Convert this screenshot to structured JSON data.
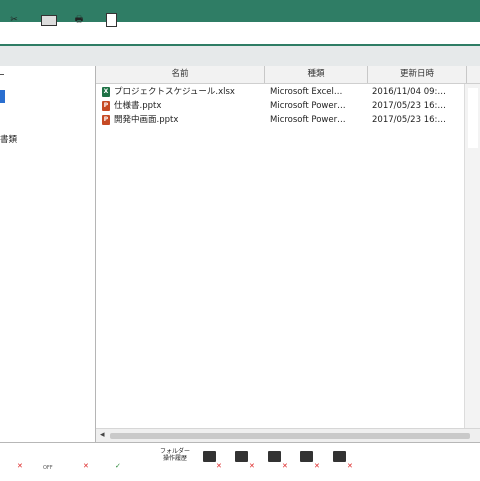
{
  "list_view": {
    "columns": [
      "名前",
      "種類",
      "更新日時"
    ],
    "rows": [
      {
        "name": "プロジェクトスケジュール.xlsx",
        "type": "Microsoft Excel…",
        "date": "2016/11/04 09:…",
        "icon": "excel-file-icon"
      },
      {
        "name": "仕様書.pptx",
        "type": "Microsoft Power…",
        "date": "2017/05/23 16:…",
        "icon": "powerpoint-file-icon"
      },
      {
        "name": "開発中画面.pptx",
        "type": "Microsoft Power…",
        "date": "2017/05/23 16:…",
        "icon": "powerpoint-file-icon"
      }
    ]
  },
  "tree": {
    "label": "書類"
  },
  "toolbar": {
    "folder_history": "フォルダー\n操作履歴",
    "off_label": "OFF"
  },
  "colors": {
    "title_bar": "#2f7d65",
    "excel": "#1e7145",
    "powerpoint": "#c64a24"
  }
}
